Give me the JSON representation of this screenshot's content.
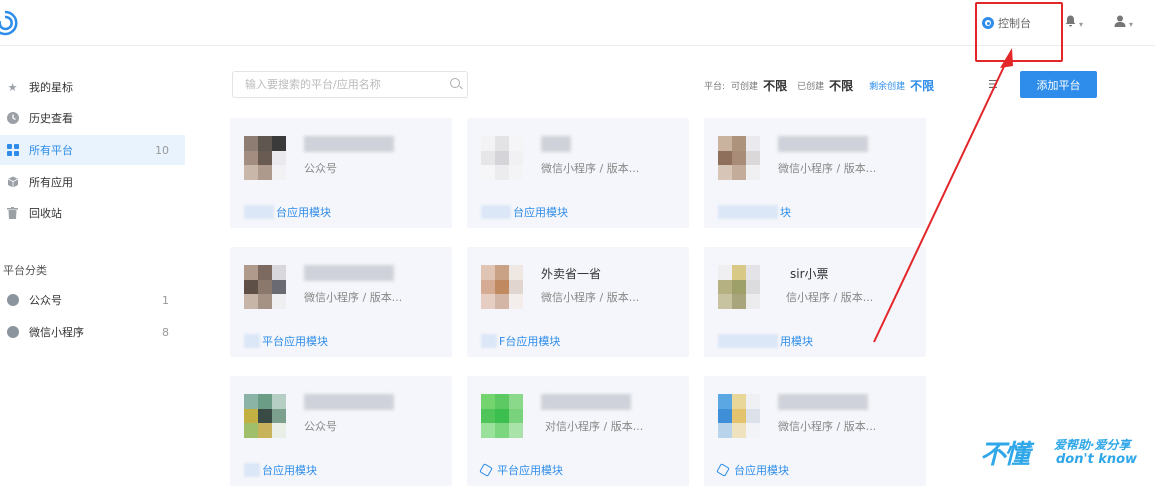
{
  "header": {
    "console_label": "控制台",
    "bell_icon": "bell-icon",
    "user_icon": "user-icon"
  },
  "sidebar": {
    "items": [
      {
        "label": "我的星标",
        "icon": "star-icon",
        "count": ""
      },
      {
        "label": "历史查看",
        "icon": "clock-icon",
        "count": ""
      },
      {
        "label": "所有平台",
        "icon": "grid-icon",
        "count": "10"
      },
      {
        "label": "所有应用",
        "icon": "cube-icon",
        "count": ""
      },
      {
        "label": "回收站",
        "icon": "trash-icon",
        "count": ""
      }
    ],
    "category_title": "平台分类",
    "categories": [
      {
        "label": "公众号",
        "icon": "wechat-icon",
        "count": "1"
      },
      {
        "label": "微信小程序",
        "icon": "miniprogram-icon",
        "count": "8"
      }
    ]
  },
  "toolbar": {
    "search_placeholder": "输入要搜索的平台/应用名称",
    "stats": {
      "platform_label": "平台:",
      "can_create_label": "可创建",
      "can_create_value": "不限",
      "created_label": "已创建",
      "created_value": "不限",
      "remaining_label": "剩余创建",
      "remaining_value": "不限"
    },
    "add_button": "添加平台"
  },
  "cards": [
    {
      "name": "",
      "type": "公众号",
      "footer": "台应用模块"
    },
    {
      "name": "",
      "type": "微信小程序 / 版本...",
      "footer": "台应用模块"
    },
    {
      "name": "",
      "type": "微信小程序 / 版本...",
      "footer": "块"
    },
    {
      "name": "",
      "type": "微信小程序 / 版本...",
      "footer": "平台应用模块"
    },
    {
      "name": "外卖省一省",
      "type": "微信小程序 / 版本...",
      "footer": "F台应用模块"
    },
    {
      "name": "sir小票",
      "type": "信小程序 / 版本...",
      "footer": "用模块"
    },
    {
      "name": "",
      "type": "公众号",
      "footer": "台应用模块"
    },
    {
      "name": "",
      "type": "对信小程序 / 版本...",
      "footer": "平台应用模块"
    },
    {
      "name": "",
      "type": "微信小程序 / 版本...",
      "footer": "台应用模块"
    }
  ],
  "watermark": {
    "big": "不懂",
    "top": "爱帮助·爱分享",
    "bottom": "don't know"
  },
  "colors": {
    "accent": "#2e8dea",
    "highlight": "#e3262a",
    "card_bg": "#f5f6fb"
  }
}
